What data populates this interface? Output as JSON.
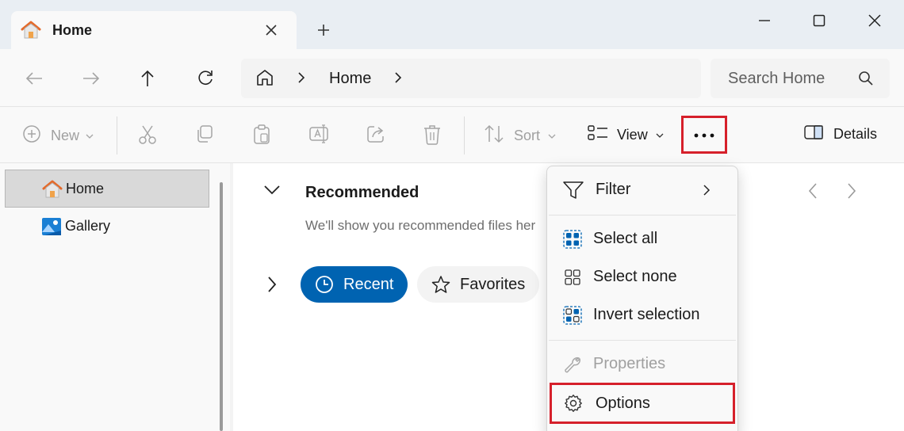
{
  "window": {
    "tab_title": "Home",
    "accent": "#0063b1",
    "highlight": "#d6202b"
  },
  "navbar": {
    "address_label": "Home",
    "search_placeholder": "Search Home"
  },
  "commandbar": {
    "new_label": "New",
    "sort_label": "Sort",
    "view_label": "View",
    "details_label": "Details"
  },
  "sidebar": {
    "items": [
      {
        "label": "Home",
        "icon": "home-icon",
        "selected": true
      },
      {
        "label": "Gallery",
        "icon": "gallery-icon",
        "selected": false
      }
    ]
  },
  "main": {
    "section_title": "Recommended",
    "section_desc": "We'll show you recommended files her",
    "pills": [
      {
        "label": "Recent",
        "icon": "clock-icon",
        "active": true
      },
      {
        "label": "Favorites",
        "icon": "star-icon",
        "active": false
      }
    ]
  },
  "menu": {
    "items": [
      {
        "label": "Filter",
        "icon": "filter-icon",
        "enabled": true
      },
      {
        "label": "Select all",
        "icon": "select-all-icon",
        "enabled": true
      },
      {
        "label": "Select none",
        "icon": "select-none-icon",
        "enabled": true
      },
      {
        "label": "Invert selection",
        "icon": "invert-selection-icon",
        "enabled": true
      },
      {
        "label": "Properties",
        "icon": "wrench-icon",
        "enabled": false
      },
      {
        "label": "Options",
        "icon": "gear-icon",
        "enabled": true
      }
    ]
  }
}
